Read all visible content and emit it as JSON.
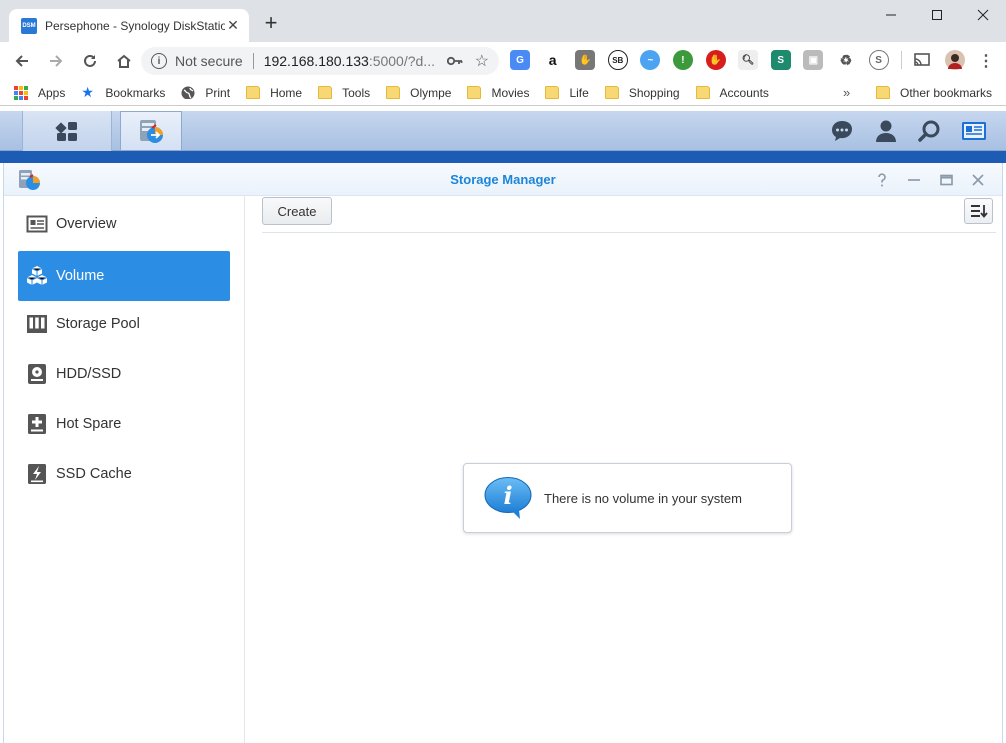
{
  "browser": {
    "tab_title": "Persephone - Synology DiskStatio",
    "favicon_text": "DSM",
    "omnibox": {
      "security": "Not secure",
      "url_host": "192.168.180.133",
      "url_rest": ":5000/?d..."
    },
    "bookmarks": [
      {
        "label": "Apps",
        "icon": "apps-grid-icon"
      },
      {
        "label": "Bookmarks",
        "icon": "star-icon"
      },
      {
        "label": "Print",
        "icon": "globe-icon"
      },
      {
        "label": "Home",
        "icon": "folder-icon"
      },
      {
        "label": "Tools",
        "icon": "folder-icon"
      },
      {
        "label": "Olympe",
        "icon": "folder-icon"
      },
      {
        "label": "Movies",
        "icon": "folder-icon"
      },
      {
        "label": "Life",
        "icon": "folder-icon"
      },
      {
        "label": "Shopping",
        "icon": "folder-icon"
      },
      {
        "label": "Accounts",
        "icon": "folder-icon"
      }
    ],
    "bookmarks_more": "»",
    "other_bookmarks": "Other bookmarks"
  },
  "window": {
    "title": "Storage Manager"
  },
  "sidebar": {
    "items": [
      {
        "label": "Overview",
        "icon": "overview-icon"
      },
      {
        "label": "Volume",
        "icon": "volume-cubes-icon",
        "active": true
      },
      {
        "label": "Storage Pool",
        "icon": "storage-pool-icon"
      },
      {
        "label": "HDD/SSD",
        "icon": "hdd-icon"
      },
      {
        "label": "Hot Spare",
        "icon": "hot-spare-icon"
      },
      {
        "label": "SSD Cache",
        "icon": "ssd-cache-icon"
      }
    ]
  },
  "content": {
    "create_label": "Create",
    "empty_message": "There is no volume in your system"
  },
  "colors": {
    "accent": "#2b8de3",
    "title_blue": "#1d85d8",
    "taskbar_strip": "#1c5cb5"
  }
}
